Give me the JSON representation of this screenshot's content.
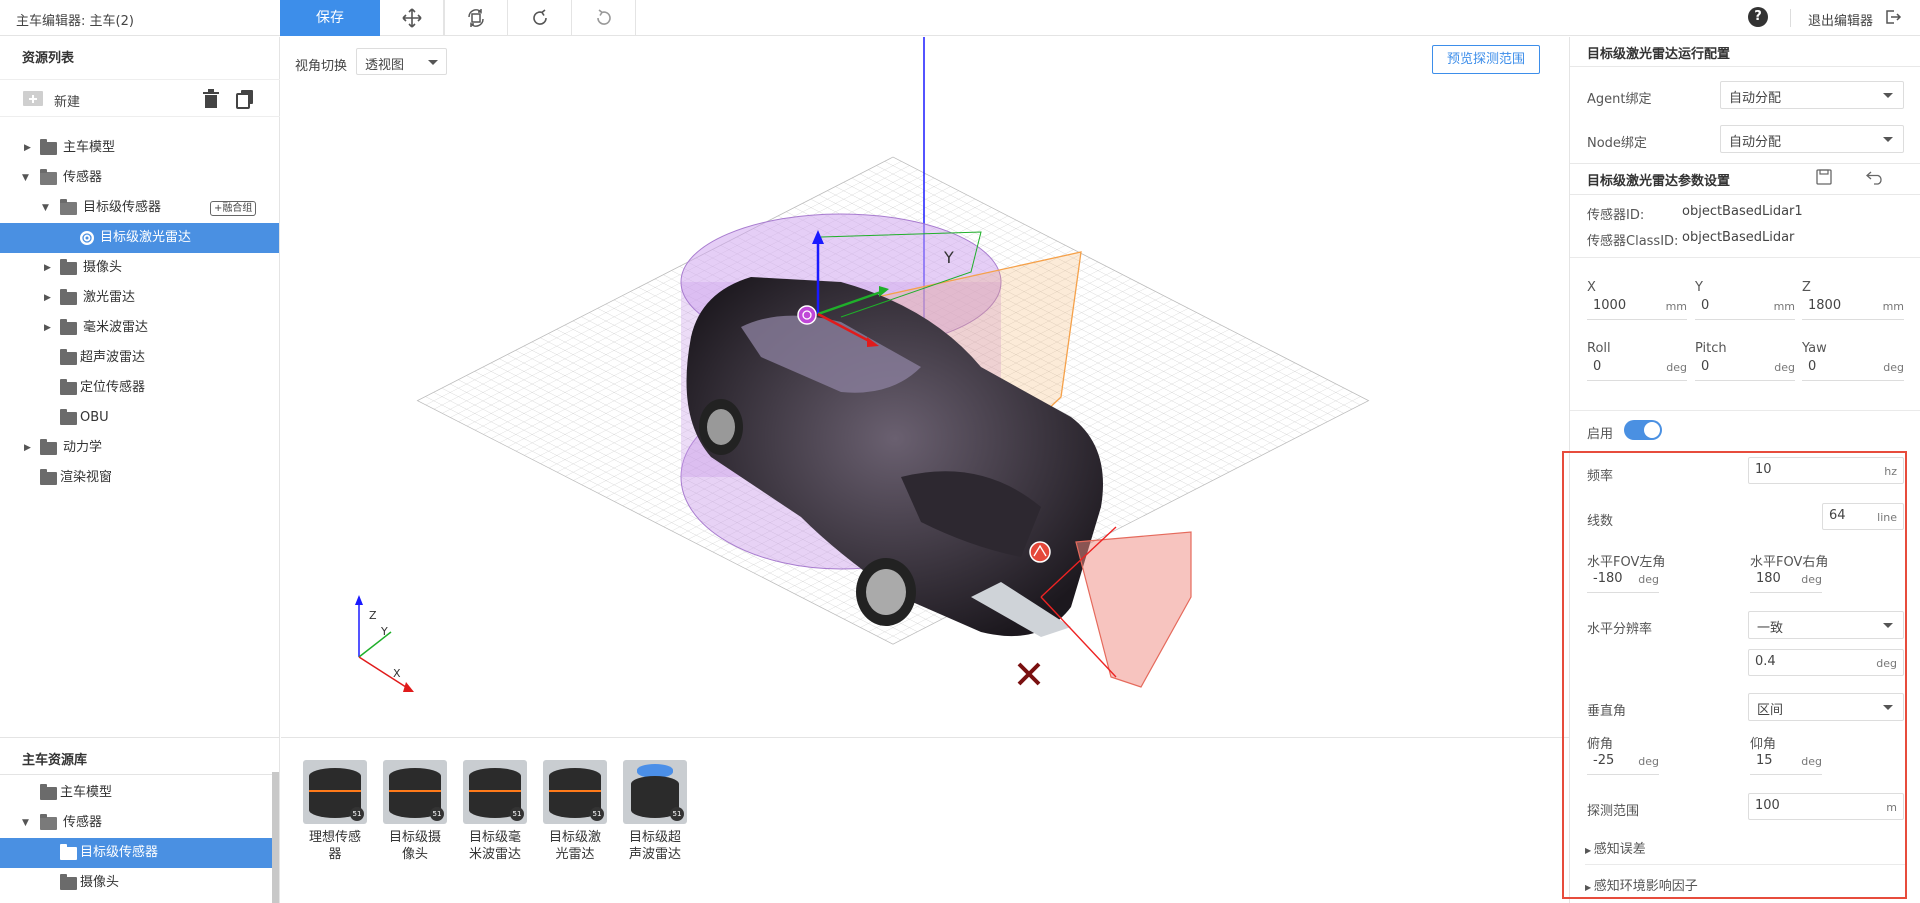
{
  "app": {
    "title": "主车编辑器: 主车(2)"
  },
  "toolbar": {
    "save_label": "保存",
    "exit_label": "退出编辑器",
    "help_label": "?"
  },
  "left": {
    "resource_title": "资源列表",
    "new_label": "新建",
    "tree": [
      {
        "label": "主车模型"
      },
      {
        "label": "传感器"
      },
      {
        "label": "目标级传感器",
        "badge": "+融合组"
      },
      {
        "label": "目标级激光雷达"
      },
      {
        "label": "摄像头"
      },
      {
        "label": "激光雷达"
      },
      {
        "label": "毫米波雷达"
      },
      {
        "label": "超声波雷达"
      },
      {
        "label": "定位传感器"
      },
      {
        "label": "OBU"
      },
      {
        "label": "动力学"
      },
      {
        "label": "渲染视窗"
      }
    ],
    "library_title": "主车资源库",
    "library": [
      {
        "label": "主车模型"
      },
      {
        "label": "传感器"
      },
      {
        "label": "目标级传感器"
      },
      {
        "label": "摄像头"
      }
    ]
  },
  "viewport": {
    "view_label": "视角切换",
    "view_value": "透视图",
    "preview_label": "预览探测范围",
    "axis_y": "Y",
    "gizmo_z": "Z",
    "gizmo_y": "Y",
    "gizmo_x": "X"
  },
  "sensors": [
    {
      "line1": "理想传感",
      "line2": "器",
      "badge": "51"
    },
    {
      "line1": "目标级摄",
      "line2": "像头",
      "badge": "51"
    },
    {
      "line1": "目标级毫",
      "line2": "米波雷达",
      "badge": "51"
    },
    {
      "line1": "目标级激",
      "line2": "光雷达",
      "badge": "51"
    },
    {
      "line1": "目标级超",
      "line2": "声波雷达",
      "badge": "51"
    }
  ],
  "right": {
    "run_title": "目标级激光雷达运行配置",
    "agent_label": "Agent绑定",
    "agent_value": "自动分配",
    "node_label": "Node绑定",
    "node_value": "自动分配",
    "param_title": "目标级激光雷达参数设置",
    "sensor_id_label": "传感器ID:",
    "sensor_id_value": "objectBasedLidar1",
    "class_id_label": "传感器ClassID:",
    "class_id_value": "objectBasedLidar",
    "x_label": "X",
    "x_value": "1000",
    "x_unit": "mm",
    "y_label": "Y",
    "y_value": "0",
    "y_unit": "mm",
    "z_label": "Z",
    "z_value": "1800",
    "z_unit": "mm",
    "roll_label": "Roll",
    "roll_value": "0",
    "roll_unit": "deg",
    "pitch_label": "Pitch",
    "pitch_value": "0",
    "pitch_unit": "deg",
    "yaw_label": "Yaw",
    "yaw_value": "0",
    "yaw_unit": "deg",
    "enable_label": "启用",
    "enabled": true,
    "freq_label": "频率",
    "freq_value": "10",
    "freq_unit": "hz",
    "lines_label": "线数",
    "lines_value": "64",
    "lines_unit": "line",
    "hfov_left_label": "水平FOV左角",
    "hfov_left_value": "-180",
    "hfov_left_unit": "deg",
    "hfov_right_label": "水平FOV右角",
    "hfov_right_value": "180",
    "hfov_right_unit": "deg",
    "hres_label": "水平分辨率",
    "hres_mode": "一致",
    "hres_value": "0.4",
    "hres_unit": "deg",
    "vangle_label": "垂直角",
    "vangle_mode": "区间",
    "depression_label": "俯角",
    "depression_value": "-25",
    "depression_unit": "deg",
    "elevation_label": "仰角",
    "elevation_value": "15",
    "elevation_unit": "deg",
    "range_label": "探测范围",
    "range_value": "100",
    "range_unit": "m",
    "error_label": "感知误差",
    "env_label": "感知环境影响因子"
  },
  "colors": {
    "accent": "#3d8eea",
    "selected": "#4a90e2",
    "highlight": "#e74c3c",
    "lidar_volume": "#c99be8",
    "camera_fov": "#f5b062",
    "radar_fov": "#f08a80"
  }
}
